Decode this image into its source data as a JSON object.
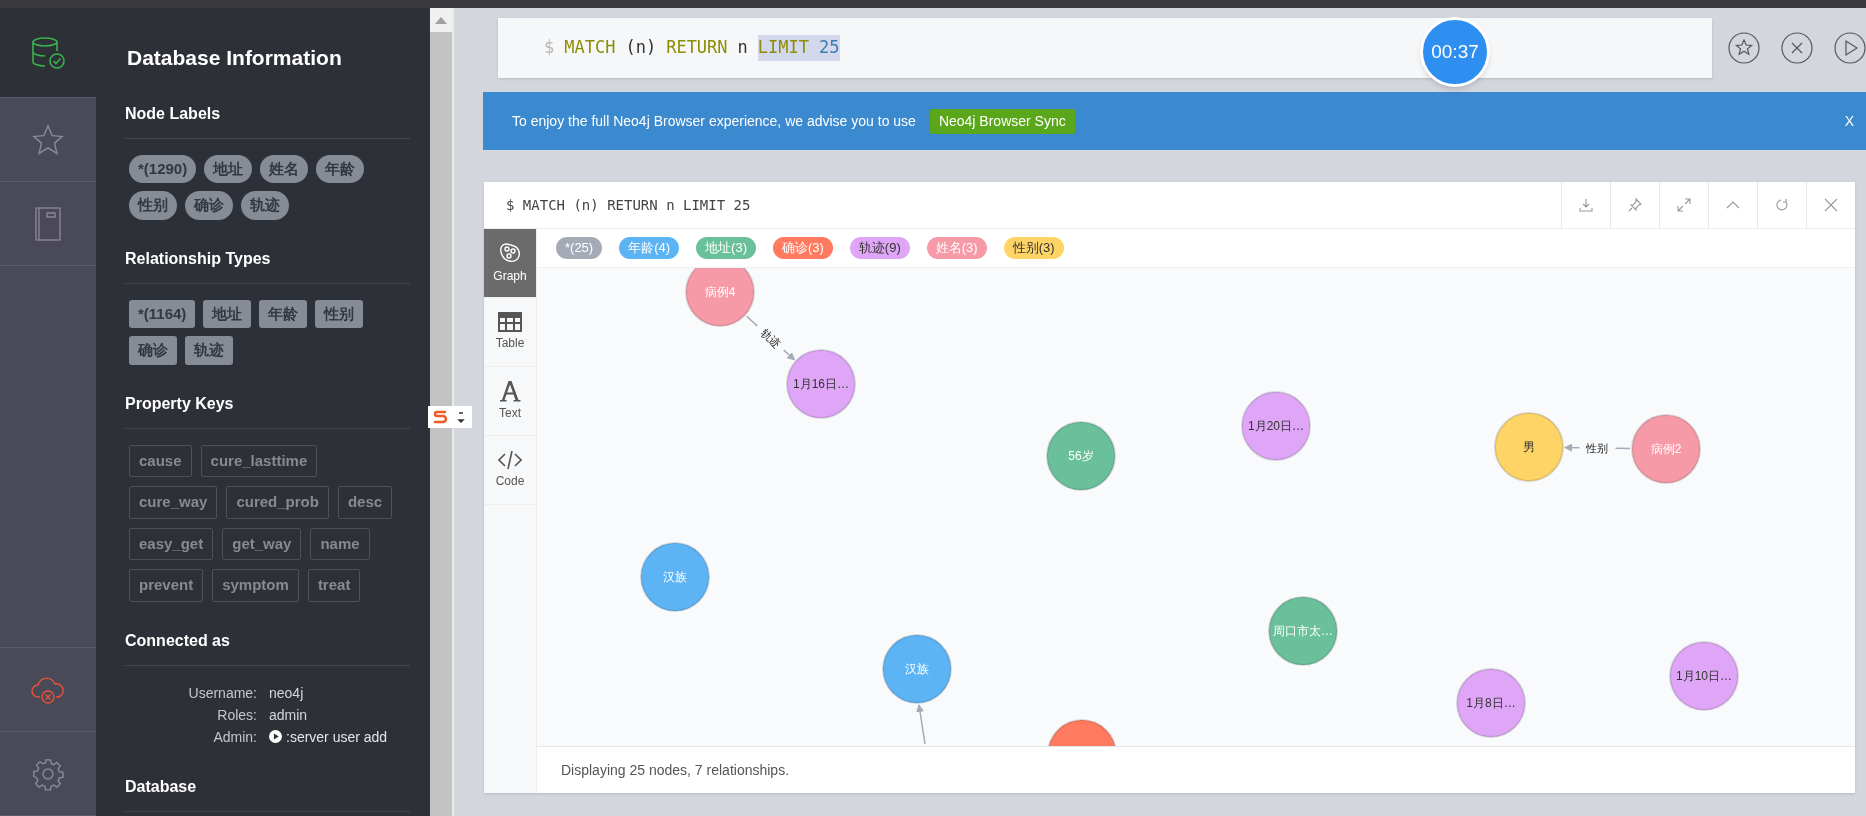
{
  "rail": {
    "items": [
      {
        "kind": "database",
        "selected": true
      },
      {
        "kind": "favorites",
        "selected": false
      },
      {
        "kind": "documents",
        "selected": false
      }
    ],
    "bottom_items": [
      {
        "kind": "connection",
        "selected": false
      },
      {
        "kind": "settings",
        "selected": false
      }
    ]
  },
  "sidebar": {
    "title": "Database Information",
    "sections": [
      {
        "heading": "Node Labels",
        "kind": "labels",
        "items": [
          "*(1290)",
          "地址",
          "姓名",
          "年龄",
          "性别",
          "确诊",
          "轨迹"
        ]
      },
      {
        "heading": "Relationship Types",
        "kind": "types",
        "items": [
          "*(1164)",
          "地址",
          "年龄",
          "性别",
          "确诊",
          "轨迹"
        ]
      },
      {
        "heading": "Property Keys",
        "kind": "keys",
        "items": [
          "cause",
          "cure_lasttime",
          "cure_way",
          "cured_prob",
          "desc",
          "easy_get",
          "get_way",
          "name",
          "prevent",
          "symptom",
          "treat"
        ]
      },
      {
        "heading": "Connected as",
        "kind": "connection",
        "rows": [
          {
            "label": "Username:",
            "value": "neo4j",
            "kind": "text"
          },
          {
            "label": "Roles:",
            "value": "admin",
            "kind": "text"
          },
          {
            "label": "Admin:",
            "value": ":server user add",
            "kind": "command"
          }
        ]
      },
      {
        "heading": "Database",
        "kind": "empty"
      }
    ]
  },
  "editor": {
    "tokens": [
      {
        "text": "$",
        "kind": "prompt",
        "selected": false
      },
      {
        "text": "MATCH",
        "kind": "keyword",
        "selected": false
      },
      {
        "text": "(n)",
        "kind": "plain",
        "selected": false
      },
      {
        "text": "RETURN",
        "kind": "keyword",
        "selected": false
      },
      {
        "text": "n",
        "kind": "plain",
        "selected": false
      },
      {
        "text": "LIMIT",
        "kind": "keyword",
        "selected": true
      },
      {
        "text": "25",
        "kind": "number",
        "selected": true
      }
    ],
    "timer": "00:37"
  },
  "banner": {
    "text": "To enjoy the full Neo4j Browser experience, we advise you to use",
    "button": "Neo4j Browser Sync",
    "close": "X"
  },
  "result": {
    "query": "$ MATCH (n) RETURN n LIMIT 25",
    "views": [
      {
        "label": "Graph",
        "kind": "graph",
        "selected": true
      },
      {
        "label": "Table",
        "kind": "table",
        "selected": false
      },
      {
        "label": "Text",
        "kind": "text",
        "selected": false
      },
      {
        "label": "Code",
        "kind": "code",
        "selected": false
      }
    ],
    "legend": [
      {
        "label": "*(25)",
        "color": "#a5abb6"
      },
      {
        "label": "年龄(4)",
        "color": "#5db4f5"
      },
      {
        "label": "地址(3)",
        "color": "#6ac09b"
      },
      {
        "label": "确诊(3)",
        "color": "#ff7a5e"
      },
      {
        "label": "轨迹(9)",
        "color": "#dfa6f8"
      },
      {
        "label": "姓名(3)",
        "color": "#f79aa8"
      },
      {
        "label": "性别(3)",
        "color": "#ffd466"
      }
    ],
    "graph": {
      "nodes": [
        {
          "caption": "病例4",
          "color": "#f79aa8"
        },
        {
          "caption": "1月16日…",
          "color": "#dfa6f8"
        },
        {
          "caption": "56岁",
          "color": "#6ac09b"
        },
        {
          "caption": "1月20日…",
          "color": "#dfa6f8"
        },
        {
          "caption": "男",
          "color": "#ffd466"
        },
        {
          "caption": "病例2",
          "color": "#f79aa8"
        },
        {
          "caption": "汉族",
          "color": "#5db4f5"
        },
        {
          "caption": "周口市太…",
          "color": "#6ac09b"
        },
        {
          "caption": "汉族",
          "color": "#5db4f5"
        },
        {
          "caption": "1月8日…",
          "color": "#dfa6f8"
        },
        {
          "caption": "1月10日…",
          "color": "#dfa6f8"
        },
        {
          "color": "#ff7a5e"
        }
      ],
      "relationships": [
        {
          "label": "轨迹"
        },
        {
          "label": "性别"
        }
      ]
    },
    "status": "Displaying 25 nodes, 7 relationships."
  }
}
